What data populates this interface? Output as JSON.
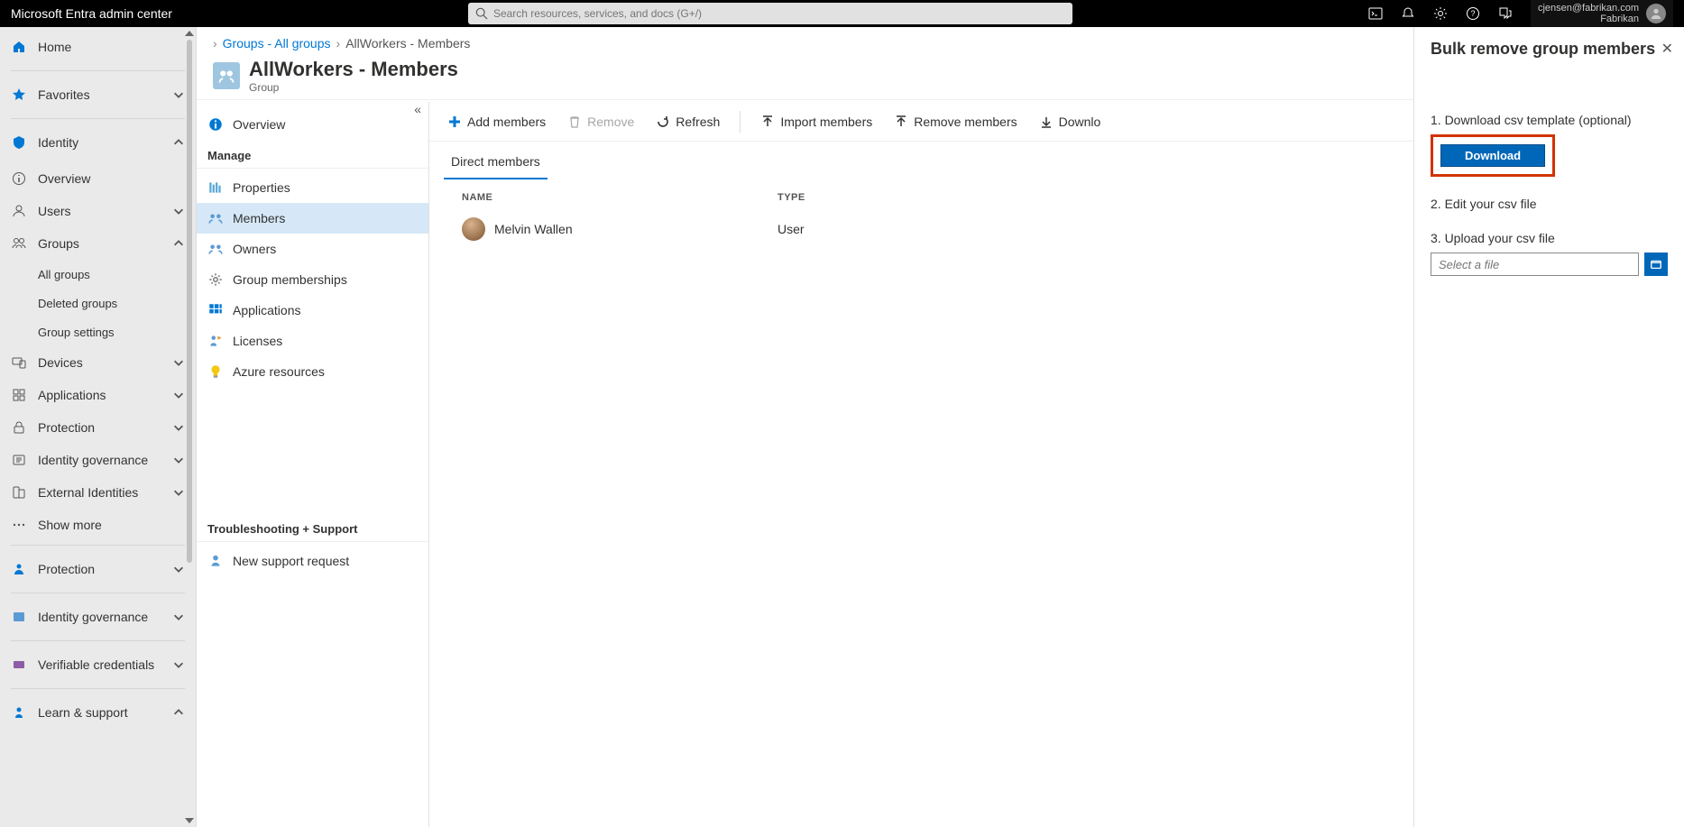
{
  "topbar": {
    "title": "Microsoft Entra admin center",
    "search_placeholder": "Search resources, services, and docs (G+/)",
    "account_email": "cjensen@fabrikan.com",
    "account_org": "Fabrikan"
  },
  "leftnav": {
    "home": "Home",
    "favorites": "Favorites",
    "identity": "Identity",
    "identity_items": {
      "overview": "Overview",
      "users": "Users",
      "groups": "Groups",
      "groups_sub": [
        "All groups",
        "Deleted groups",
        "Group settings"
      ],
      "devices": "Devices",
      "applications": "Applications",
      "protection": "Protection",
      "id_governance": "Identity governance",
      "ext_identities": "External Identities",
      "show_more": "Show more"
    },
    "protection2": "Protection",
    "id_gov2": "Identity governance",
    "ver_creds": "Verifiable credentials",
    "learn_support": "Learn & support"
  },
  "breadcrumb": {
    "groups": "Groups - All groups",
    "current": "AllWorkers - Members"
  },
  "blade": {
    "title": "AllWorkers - Members",
    "subtitle": "Group"
  },
  "resmenu": {
    "overview": "Overview",
    "manage": "Manage",
    "properties": "Properties",
    "members": "Members",
    "owners": "Owners",
    "group_memberships": "Group memberships",
    "applications": "Applications",
    "licenses": "Licenses",
    "azure_resources": "Azure resources",
    "troubleshoot": "Troubleshooting + Support",
    "new_support": "New support request"
  },
  "toolbar": {
    "add": "Add members",
    "remove": "Remove",
    "refresh": "Refresh",
    "import": "Import members",
    "remove_members": "Remove members",
    "download": "Downlo"
  },
  "tabs": {
    "direct": "Direct members"
  },
  "table": {
    "headers": {
      "name": "NAME",
      "type": "TYPE"
    },
    "rows": [
      {
        "name": "Melvin Wallen",
        "type": "User"
      }
    ]
  },
  "panel": {
    "title": "Bulk remove group members",
    "step1": "1. Download csv template (optional)",
    "download": "Download",
    "step2": "2. Edit your csv file",
    "step3": "3. Upload your csv file",
    "file_placeholder": "Select a file"
  }
}
